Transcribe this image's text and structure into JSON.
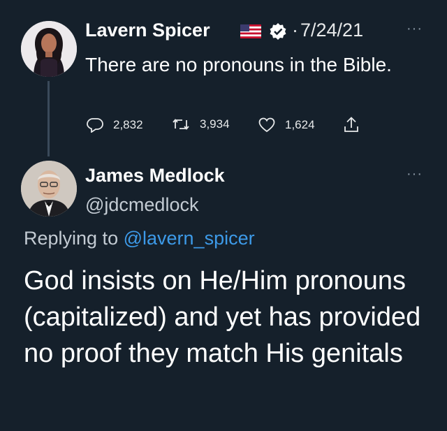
{
  "tweet1": {
    "author_name": "Lavern Spicer",
    "separator": "·",
    "date": "7/24/21",
    "more": "···",
    "text": "There are no pronouns in the Bible.",
    "reply_count": "2,832",
    "retweet_count": "3,934",
    "like_count": "1,624"
  },
  "tweet2": {
    "author_name": "James Medlock",
    "handle": "@jdcmedlock",
    "more": "···",
    "replying_prefix": "Replying to",
    "replying_handle": "@lavern_spicer",
    "text": "God insists on He/Him pronouns (capitalized) and yet has provided no proof they match His genitals"
  },
  "colors": {
    "background": "#15202b",
    "link": "#3d9ae8",
    "muted": "#c3cbd3",
    "icon": "#8b98a5"
  },
  "icons": [
    "reply-icon",
    "retweet-icon",
    "like-icon",
    "share-icon",
    "verified-badge-icon",
    "us-flag-icon"
  ]
}
